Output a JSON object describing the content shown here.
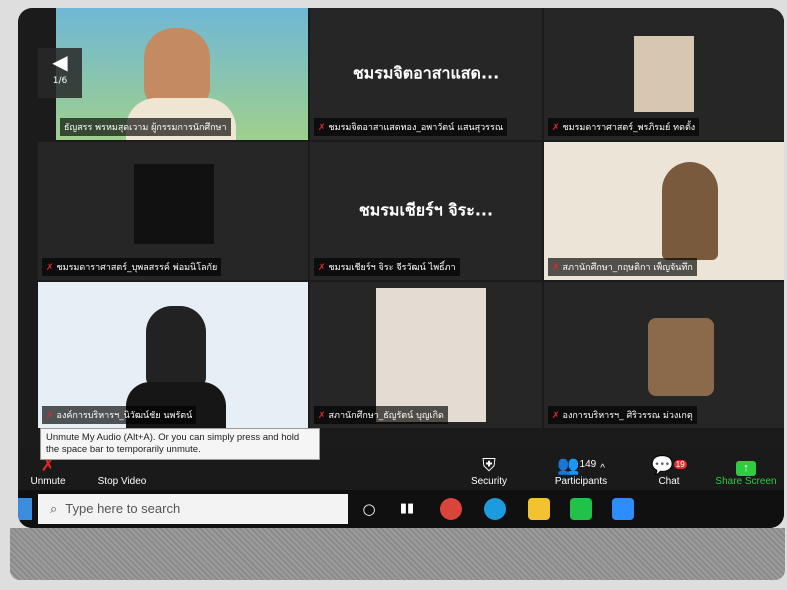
{
  "window": {
    "page_indicator": "1/6"
  },
  "tiles": [
    {
      "kind": "video",
      "name": "ธัญสรร พรหมสุดเวาม ผู้กรรมการนักศึกษา",
      "active": true
    },
    {
      "kind": "text",
      "title": "ชมรมจิตอาสาแสด...",
      "name": "ชมรมจิตอาสาแสดทอง_อพาวัตน์ แสนสุวรรณ"
    },
    {
      "kind": "video",
      "name": "ชมรมดาราศาสตร์_พรภิรมย์ ทดตั้ง"
    },
    {
      "kind": "video",
      "name": "ชมรมดาราศาสตร์_บุพลสรรค์ พ่อมนิโลกัย"
    },
    {
      "kind": "text",
      "title": "ชมรมเชียร์ฯ จิระ...",
      "name": "ชมรมเชียร์ฯ จิระ จีรวัฒน์ ไพธิ์ภา"
    },
    {
      "kind": "video",
      "name": "สภานักศึกษา_กฤษติกา เพ็ญจันทึก"
    },
    {
      "kind": "video",
      "name": "องค์การบริหารฯ_นิวัฒน์ชัย นพรัตน์"
    },
    {
      "kind": "video",
      "name": "สภานักศึกษา_ธัญรัตน์ บุญเกิด"
    },
    {
      "kind": "video",
      "name": "องการบริหารฯ_ ศิริวรรณ ม่วงเกตุ"
    }
  ],
  "tooltip": "Unmute My Audio (Alt+A). Or you can simply press and hold the space bar to temporarily unmute.",
  "controls": {
    "unmute": "Unmute",
    "stop_video": "Stop Video",
    "security": "Security",
    "participants": "Participants",
    "participants_count": "149",
    "chat": "Chat",
    "chat_badge": "19",
    "share_screen": "Share Screen"
  },
  "taskbar": {
    "search_placeholder": "Type here to search"
  },
  "colors": {
    "share_green": "#2ecc40",
    "active_speaker": "#d6d61d",
    "muted_red": "#e02828",
    "chat_badge": "#e03030"
  }
}
